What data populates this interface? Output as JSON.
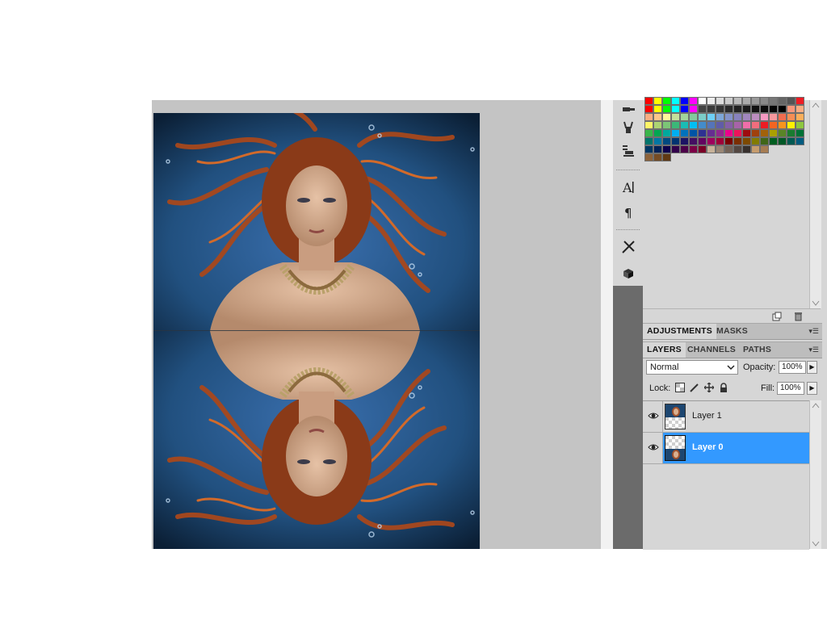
{
  "panels": {
    "adjustments_tabs": [
      "ADJUSTMENTS",
      "MASKS"
    ],
    "layers_tabs": [
      "LAYERS",
      "CHANNELS",
      "PATHS"
    ],
    "active_adjustments_tab": "ADJUSTMENTS",
    "active_layers_tab": "LAYERS"
  },
  "layers_panel": {
    "blend_mode": "Normal",
    "opacity_label": "Opacity:",
    "opacity_value": "100%",
    "lock_label": "Lock:",
    "fill_label": "Fill:",
    "fill_value": "100%",
    "layers": [
      {
        "name": "Layer 1",
        "visible": true,
        "selected": false
      },
      {
        "name": "Layer 0",
        "visible": true,
        "selected": true
      }
    ]
  },
  "tools": [
    "clone-source-icon",
    "brush-presets-icon",
    "tool-presets-icon",
    "character-icon",
    "paragraph-icon",
    "brushes-icon",
    "3d-icon"
  ],
  "swatch_rows": [
    [
      "#ff0000",
      "#ffff00",
      "#00ff00",
      "#00ffff",
      "#0000ff",
      "#ff00ff",
      "#ffffff",
      "#eeeeee",
      "#dddddd",
      "#cccccc",
      "#bbbbbb",
      "#aaaaaa",
      "#999999",
      "#888888",
      "#777777",
      "#666666",
      "#555555",
      "#ee1c24"
    ],
    [
      "#ff0000",
      "#ffff00",
      "#00ff00",
      "#00ffff",
      "#0000ff",
      "#ff00ff",
      "#444444",
      "#3a3a3a",
      "#333333",
      "#2a2a2a",
      "#222222",
      "#1a1a1a",
      "#111111",
      "#0a0a0a",
      "#050505",
      "#000000",
      "#f7977a",
      "#fbad82"
    ],
    [
      "#f9ad81",
      "#fdc68a",
      "#fff79a",
      "#c4df9b",
      "#a3d39c",
      "#82ca9d",
      "#7bcdc8",
      "#6ecff6",
      "#7ea7d8",
      "#8493ca",
      "#8882be",
      "#a187be",
      "#bc8dbf",
      "#f49ac2",
      "#f6989d",
      "#f26c4f",
      "#f68e55",
      "#fbaf5c"
    ],
    [
      "#fff467",
      "#acd372",
      "#7cc576",
      "#3bb878",
      "#1abbb4",
      "#00bff3",
      "#438ccb",
      "#5574b9",
      "#605ca8",
      "#855fa8",
      "#a763a8",
      "#f06ea9",
      "#f26d7d",
      "#ed1c24",
      "#f26522",
      "#f7941d",
      "#fff200",
      "#8dc73f"
    ],
    [
      "#39b54a",
      "#00a651",
      "#00a99d",
      "#00aeef",
      "#0072bc",
      "#0054a6",
      "#2e3192",
      "#662d91",
      "#92278f",
      "#ec008c",
      "#ed145b",
      "#9e0b0f",
      "#a0410d",
      "#a3620a",
      "#aba000",
      "#598527",
      "#1a7b30",
      "#007236"
    ],
    [
      "#00746b",
      "#0076a3",
      "#004a80",
      "#003471",
      "#1b1464",
      "#440e62",
      "#630460",
      "#9e005d",
      "#9e0039",
      "#790000",
      "#7b2e00",
      "#7d4900",
      "#827b00",
      "#406618",
      "#005e20",
      "#005826",
      "#005952",
      "#005b7f"
    ],
    [
      "#003663",
      "#002157",
      "#0d004c",
      "#32004b",
      "#4b0049",
      "#7b0046",
      "#7a0026",
      "#c7b299",
      "#998675",
      "#736357",
      "#534741",
      "#37302d",
      "#c69c6d",
      "#a67c52"
    ],
    [
      "#8c6239",
      "#754c24",
      "#603913"
    ]
  ]
}
